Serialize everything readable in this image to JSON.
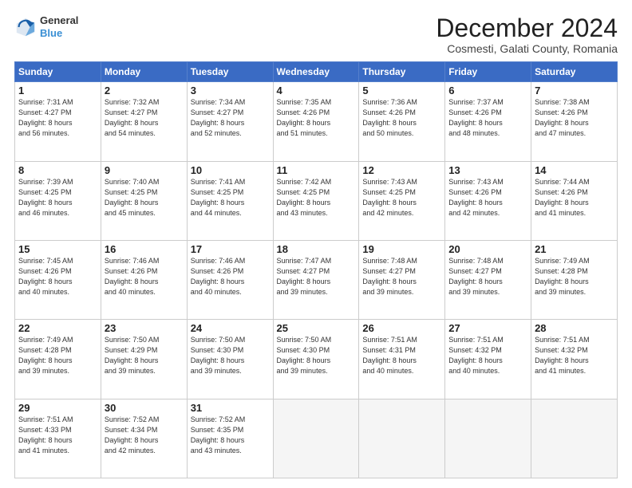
{
  "header": {
    "logo_line1": "General",
    "logo_line2": "Blue",
    "month_title": "December 2024",
    "subtitle": "Cosmesti, Galati County, Romania"
  },
  "weekdays": [
    "Sunday",
    "Monday",
    "Tuesday",
    "Wednesday",
    "Thursday",
    "Friday",
    "Saturday"
  ],
  "weeks": [
    [
      {
        "day": "1",
        "info": "Sunrise: 7:31 AM\nSunset: 4:27 PM\nDaylight: 8 hours\nand 56 minutes."
      },
      {
        "day": "2",
        "info": "Sunrise: 7:32 AM\nSunset: 4:27 PM\nDaylight: 8 hours\nand 54 minutes."
      },
      {
        "day": "3",
        "info": "Sunrise: 7:34 AM\nSunset: 4:27 PM\nDaylight: 8 hours\nand 52 minutes."
      },
      {
        "day": "4",
        "info": "Sunrise: 7:35 AM\nSunset: 4:26 PM\nDaylight: 8 hours\nand 51 minutes."
      },
      {
        "day": "5",
        "info": "Sunrise: 7:36 AM\nSunset: 4:26 PM\nDaylight: 8 hours\nand 50 minutes."
      },
      {
        "day": "6",
        "info": "Sunrise: 7:37 AM\nSunset: 4:26 PM\nDaylight: 8 hours\nand 48 minutes."
      },
      {
        "day": "7",
        "info": "Sunrise: 7:38 AM\nSunset: 4:26 PM\nDaylight: 8 hours\nand 47 minutes."
      }
    ],
    [
      {
        "day": "8",
        "info": "Sunrise: 7:39 AM\nSunset: 4:25 PM\nDaylight: 8 hours\nand 46 minutes."
      },
      {
        "day": "9",
        "info": "Sunrise: 7:40 AM\nSunset: 4:25 PM\nDaylight: 8 hours\nand 45 minutes."
      },
      {
        "day": "10",
        "info": "Sunrise: 7:41 AM\nSunset: 4:25 PM\nDaylight: 8 hours\nand 44 minutes."
      },
      {
        "day": "11",
        "info": "Sunrise: 7:42 AM\nSunset: 4:25 PM\nDaylight: 8 hours\nand 43 minutes."
      },
      {
        "day": "12",
        "info": "Sunrise: 7:43 AM\nSunset: 4:25 PM\nDaylight: 8 hours\nand 42 minutes."
      },
      {
        "day": "13",
        "info": "Sunrise: 7:43 AM\nSunset: 4:26 PM\nDaylight: 8 hours\nand 42 minutes."
      },
      {
        "day": "14",
        "info": "Sunrise: 7:44 AM\nSunset: 4:26 PM\nDaylight: 8 hours\nand 41 minutes."
      }
    ],
    [
      {
        "day": "15",
        "info": "Sunrise: 7:45 AM\nSunset: 4:26 PM\nDaylight: 8 hours\nand 40 minutes."
      },
      {
        "day": "16",
        "info": "Sunrise: 7:46 AM\nSunset: 4:26 PM\nDaylight: 8 hours\nand 40 minutes."
      },
      {
        "day": "17",
        "info": "Sunrise: 7:46 AM\nSunset: 4:26 PM\nDaylight: 8 hours\nand 40 minutes."
      },
      {
        "day": "18",
        "info": "Sunrise: 7:47 AM\nSunset: 4:27 PM\nDaylight: 8 hours\nand 39 minutes."
      },
      {
        "day": "19",
        "info": "Sunrise: 7:48 AM\nSunset: 4:27 PM\nDaylight: 8 hours\nand 39 minutes."
      },
      {
        "day": "20",
        "info": "Sunrise: 7:48 AM\nSunset: 4:27 PM\nDaylight: 8 hours\nand 39 minutes."
      },
      {
        "day": "21",
        "info": "Sunrise: 7:49 AM\nSunset: 4:28 PM\nDaylight: 8 hours\nand 39 minutes."
      }
    ],
    [
      {
        "day": "22",
        "info": "Sunrise: 7:49 AM\nSunset: 4:28 PM\nDaylight: 8 hours\nand 39 minutes."
      },
      {
        "day": "23",
        "info": "Sunrise: 7:50 AM\nSunset: 4:29 PM\nDaylight: 8 hours\nand 39 minutes."
      },
      {
        "day": "24",
        "info": "Sunrise: 7:50 AM\nSunset: 4:30 PM\nDaylight: 8 hours\nand 39 minutes."
      },
      {
        "day": "25",
        "info": "Sunrise: 7:50 AM\nSunset: 4:30 PM\nDaylight: 8 hours\nand 39 minutes."
      },
      {
        "day": "26",
        "info": "Sunrise: 7:51 AM\nSunset: 4:31 PM\nDaylight: 8 hours\nand 40 minutes."
      },
      {
        "day": "27",
        "info": "Sunrise: 7:51 AM\nSunset: 4:32 PM\nDaylight: 8 hours\nand 40 minutes."
      },
      {
        "day": "28",
        "info": "Sunrise: 7:51 AM\nSunset: 4:32 PM\nDaylight: 8 hours\nand 41 minutes."
      }
    ],
    [
      {
        "day": "29",
        "info": "Sunrise: 7:51 AM\nSunset: 4:33 PM\nDaylight: 8 hours\nand 41 minutes."
      },
      {
        "day": "30",
        "info": "Sunrise: 7:52 AM\nSunset: 4:34 PM\nDaylight: 8 hours\nand 42 minutes."
      },
      {
        "day": "31",
        "info": "Sunrise: 7:52 AM\nSunset: 4:35 PM\nDaylight: 8 hours\nand 43 minutes."
      },
      null,
      null,
      null,
      null
    ]
  ]
}
